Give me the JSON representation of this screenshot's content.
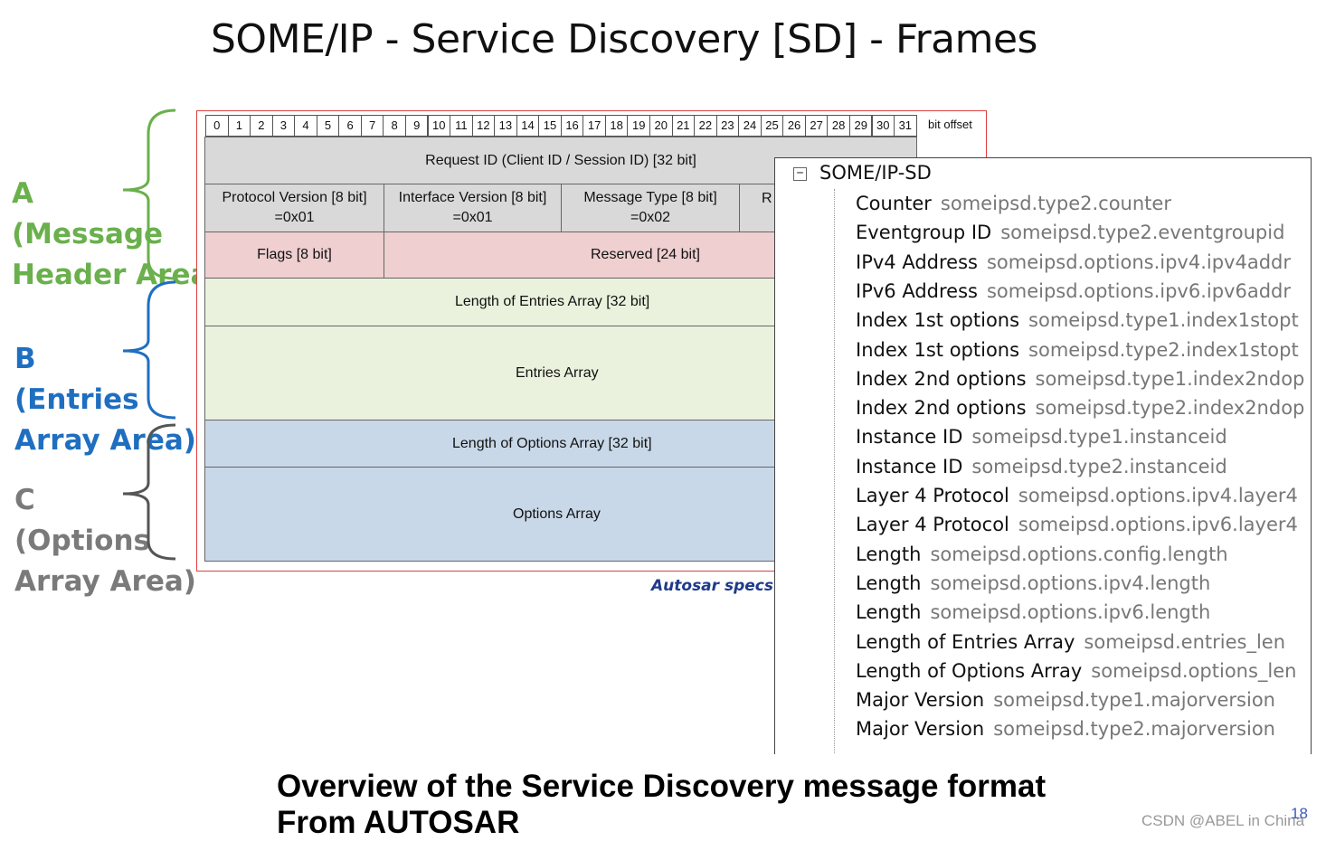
{
  "title": "SOME/IP - Service Discovery [SD] - Frames",
  "regions": [
    {
      "letter": "A",
      "lines": [
        "A",
        "(Message",
        "Header Area)"
      ],
      "color": "#6ab04c"
    },
    {
      "letter": "B",
      "lines": [
        "B",
        "(Entries",
        "Array Area)"
      ],
      "color": "#1f6fc1"
    },
    {
      "letter": "C",
      "lines": [
        "C",
        "(Options",
        "Array Area)"
      ],
      "color": "#7a7a7a"
    }
  ],
  "bit_offsets": [
    "0",
    "1",
    "2",
    "3",
    "4",
    "5",
    "6",
    "7",
    "8",
    "9",
    "10",
    "11",
    "12",
    "13",
    "14",
    "15",
    "16",
    "17",
    "18",
    "19",
    "20",
    "21",
    "22",
    "23",
    "24",
    "25",
    "26",
    "27",
    "28",
    "29",
    "30",
    "31"
  ],
  "bit_offset_label": "bit offset",
  "fields": {
    "request_id": "Request ID (Client ID / Session ID) [32 bit]",
    "protocol_version": [
      "Protocol Version [8 bit]",
      "=0x01"
    ],
    "interface_version": [
      "Interface Version [8 bit]",
      "=0x01"
    ],
    "message_type": [
      "Message Type [8 bit]",
      "=0x02"
    ],
    "return_code_partial": "R",
    "flags": "Flags [8 bit]",
    "reserved": "Reserved [24 bit]",
    "length_entries": "Length of Entries Array [32 bit]",
    "entries_array": "Entries Array",
    "length_options": "Length of Options Array [32 bit]",
    "options_array": "Options Array"
  },
  "colors": {
    "header": "#d9d9d9",
    "flags": "#efcfcf",
    "entries": "#eaf1dd",
    "options": "#c9d8e8"
  },
  "source_note": "Autosar specs",
  "tree": {
    "toggle": "⊟",
    "root": "SOME/IP-SD",
    "items": [
      {
        "name": "Counter",
        "filter": "someipsd.type2.counter"
      },
      {
        "name": "Eventgroup ID",
        "filter": "someipsd.type2.eventgroupid"
      },
      {
        "name": "IPv4 Address",
        "filter": "someipsd.options.ipv4.ipv4addr"
      },
      {
        "name": "IPv6 Address",
        "filter": "someipsd.options.ipv6.ipv6addr"
      },
      {
        "name": "Index 1st options",
        "filter": "someipsd.type1.index1stopt"
      },
      {
        "name": "Index 1st options",
        "filter": "someipsd.type2.index1stopt"
      },
      {
        "name": "Index 2nd options",
        "filter": "someipsd.type1.index2ndop"
      },
      {
        "name": "Index 2nd options",
        "filter": "someipsd.type2.index2ndop"
      },
      {
        "name": "Instance ID",
        "filter": "someipsd.type1.instanceid"
      },
      {
        "name": "Instance ID",
        "filter": "someipsd.type2.instanceid"
      },
      {
        "name": "Layer 4 Protocol",
        "filter": "someipsd.options.ipv4.layer4"
      },
      {
        "name": "Layer 4 Protocol",
        "filter": "someipsd.options.ipv6.layer4"
      },
      {
        "name": "Length",
        "filter": "someipsd.options.config.length"
      },
      {
        "name": "Length",
        "filter": "someipsd.options.ipv4.length"
      },
      {
        "name": "Length",
        "filter": "someipsd.options.ipv6.length"
      },
      {
        "name": "Length of Entries Array",
        "filter": "someipsd.entries_len"
      },
      {
        "name": "Length of Options Array",
        "filter": "someipsd.options_len"
      },
      {
        "name": "Major Version",
        "filter": "someipsd.type1.majorversion"
      },
      {
        "name": "Major Version",
        "filter": "someipsd.type2.majorversion"
      }
    ]
  },
  "caption": [
    "Overview of the Service Discovery message format",
    "From AUTOSAR"
  ],
  "watermark": "CSDN @ABEL in China",
  "page_number": "18"
}
